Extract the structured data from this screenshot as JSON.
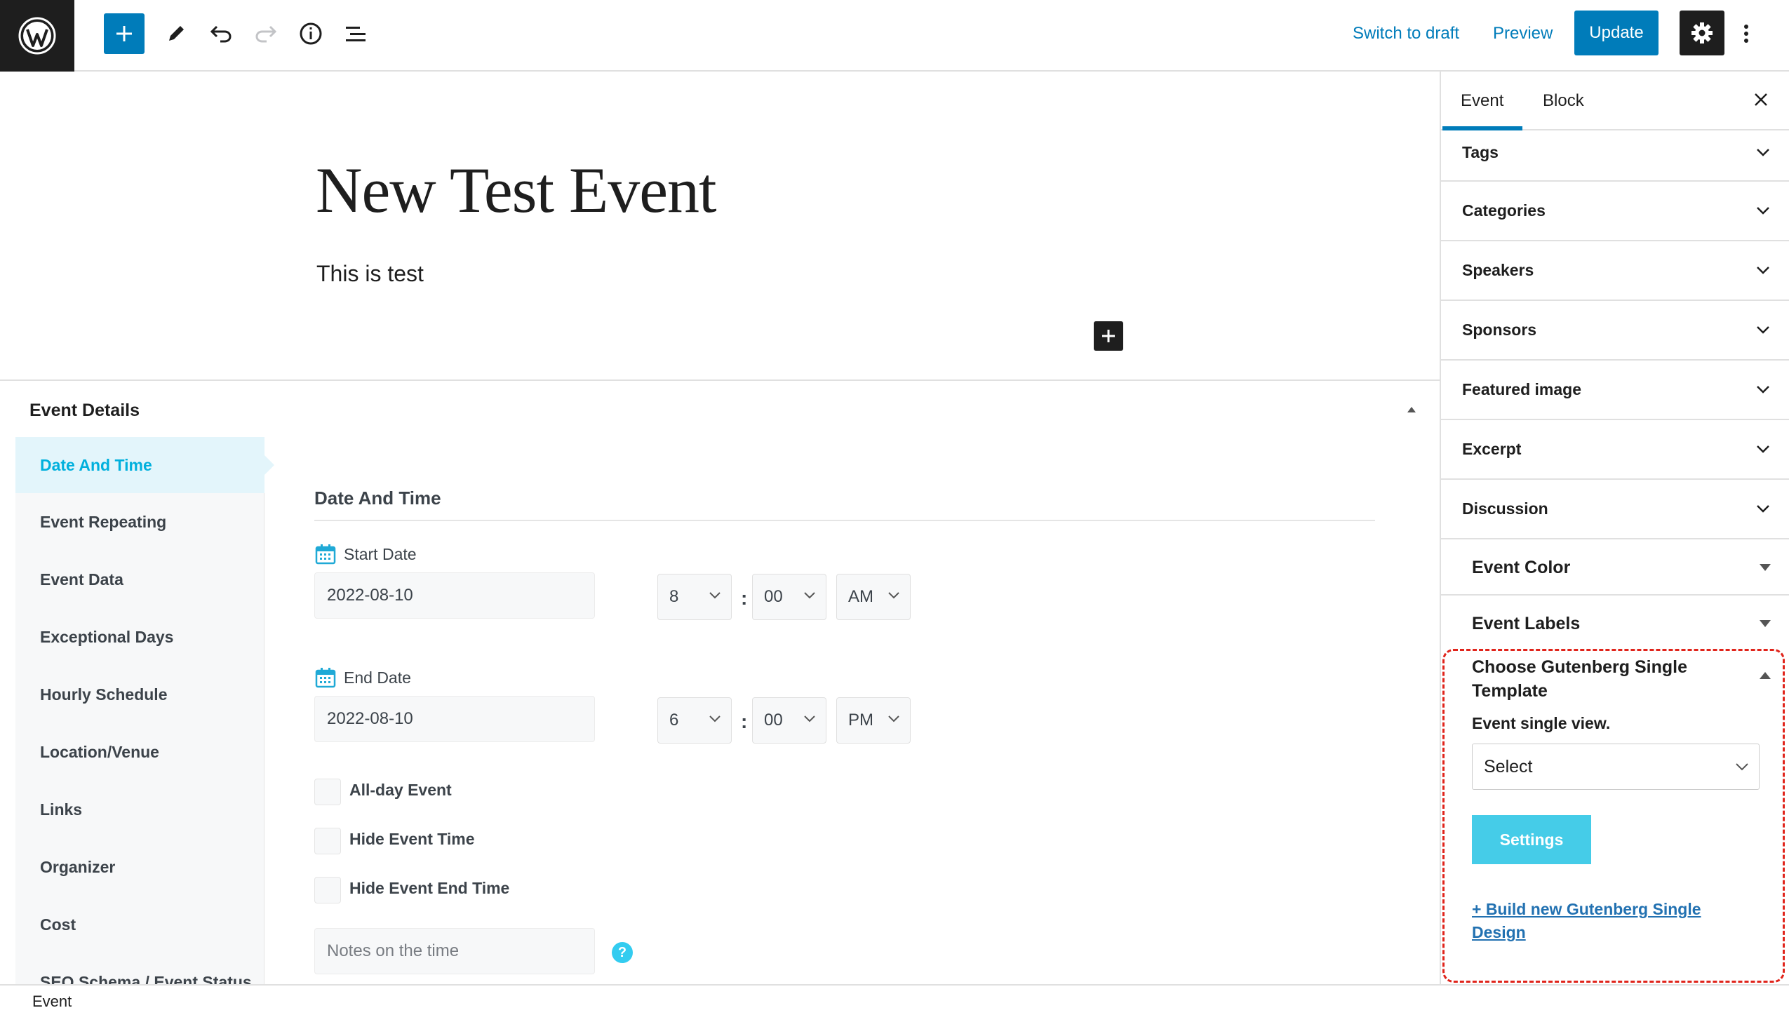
{
  "toolbar": {
    "logo": "wordpress-logo",
    "add_block": "add-block-icon",
    "tools": "pencil-icon",
    "undo": "undo-icon",
    "redo": "redo-icon",
    "details": "info-icon",
    "outline": "list-view-icon",
    "switch_to_draft": "Switch to draft",
    "preview": "Preview",
    "update": "Update",
    "settings": "gear-icon",
    "more": "kebab-icon"
  },
  "editor": {
    "title": "New Test Event",
    "paragraph": "This is test"
  },
  "metabox": {
    "title": "Event Details",
    "nav": [
      {
        "label": "Date And Time",
        "active": true
      },
      {
        "label": "Event Repeating"
      },
      {
        "label": "Event Data"
      },
      {
        "label": "Exceptional Days"
      },
      {
        "label": "Hourly Schedule"
      },
      {
        "label": "Location/Venue"
      },
      {
        "label": "Links"
      },
      {
        "label": "Organizer"
      },
      {
        "label": "Cost"
      },
      {
        "label": "SEO Schema / Event Status"
      }
    ],
    "section_title": "Date And Time",
    "start": {
      "label": "Start Date",
      "date": "2022-08-10",
      "hour": "8",
      "minute": "00",
      "ampm": "AM"
    },
    "end": {
      "label": "End Date",
      "date": "2022-08-10",
      "hour": "6",
      "minute": "00",
      "ampm": "PM"
    },
    "colon": ":",
    "checkboxes": [
      {
        "label": "All-day Event",
        "checked": false
      },
      {
        "label": "Hide Event Time",
        "checked": false
      },
      {
        "label": "Hide Event End Time",
        "checked": false
      }
    ],
    "notes_placeholder": "Notes on the time",
    "help": "?"
  },
  "footer": {
    "breadcrumb": "Event"
  },
  "sidebar": {
    "tabs": [
      "Event",
      "Block"
    ],
    "active_tab": "Event",
    "panels": [
      "Tags",
      "Categories",
      "Speakers",
      "Sponsors",
      "Featured image",
      "Excerpt",
      "Discussion"
    ],
    "event_color": "Event Color",
    "event_labels": "Event Labels",
    "gutenberg": {
      "title": "Choose Gutenberg Single Template",
      "subtitle": "Event single view.",
      "select_value": "Select",
      "settings": "Settings",
      "build_link": "+ Build new Gutenberg Single Design"
    }
  },
  "colors": {
    "accent": "#007cba",
    "metabox_accent": "#00b0dd",
    "highlight": "#e0241b",
    "settings_button": "#45cce8"
  }
}
